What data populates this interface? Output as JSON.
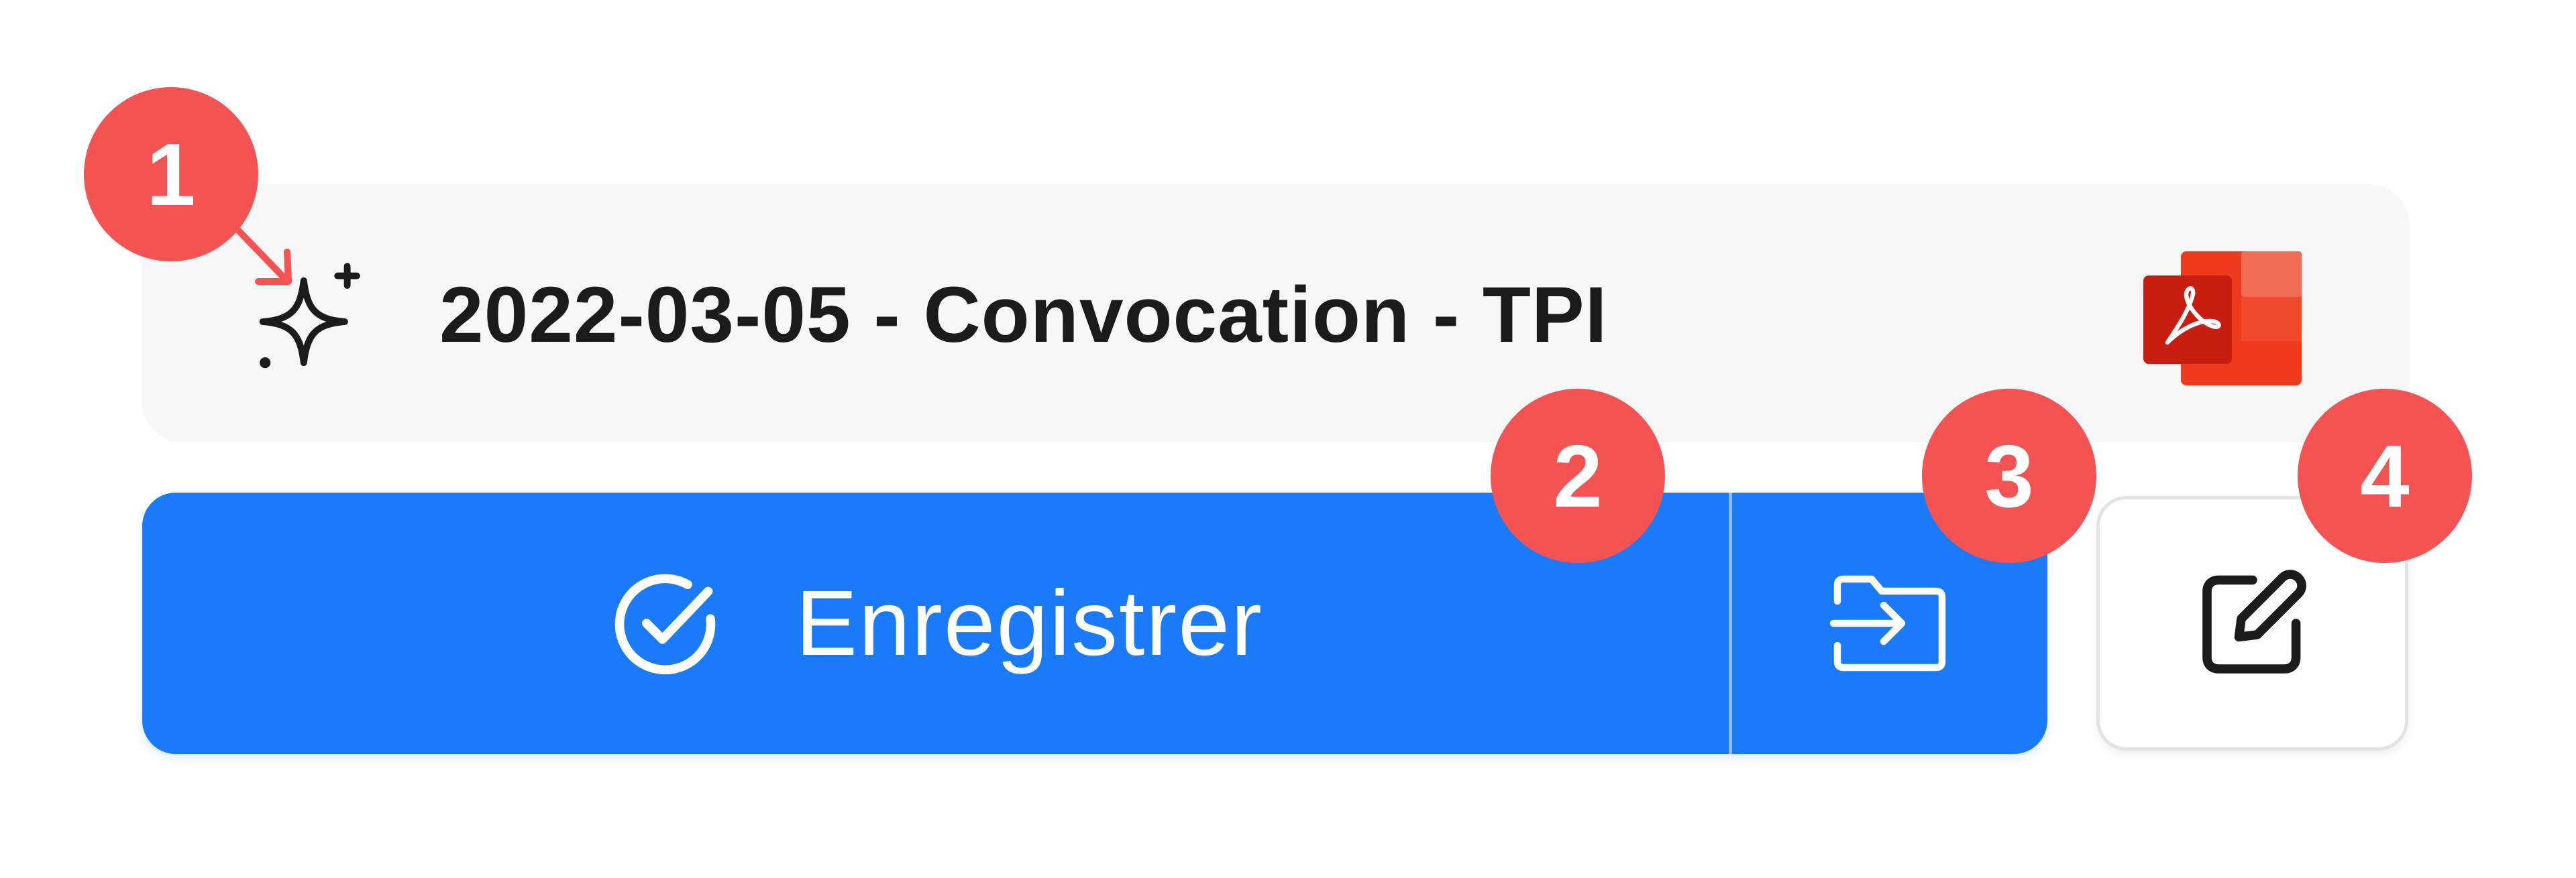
{
  "file": {
    "name": "2022-03-05 - Convocation - TPI",
    "leading_icon": "ai-sparkle-icon",
    "type_icon": "pdf-file-icon"
  },
  "actions": {
    "save_label": "Enregistrer",
    "save_icon": "check-circle-icon",
    "move_icon": "folder-import-icon",
    "edit_icon": "edit-pencil-icon"
  },
  "callouts": [
    "1",
    "2",
    "3",
    "4"
  ],
  "colors": {
    "primary": "#1a7af8",
    "callout": "#f45354",
    "card_background": "#f7f7f7",
    "pdf_red": "#e8321c"
  }
}
